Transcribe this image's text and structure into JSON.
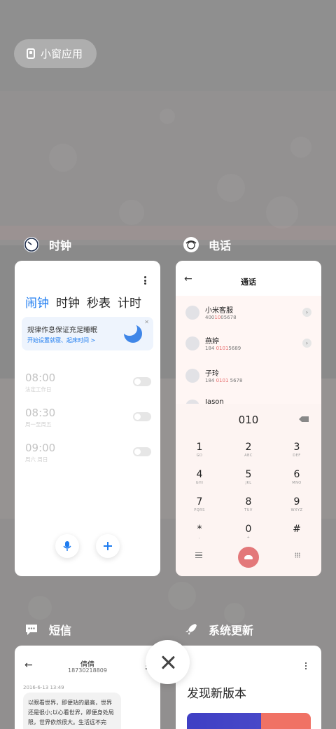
{
  "floating_button": {
    "label": "小窗应用",
    "icon": "small-window-icon"
  },
  "clock": {
    "app_name": "时钟",
    "icon": "clock-icon",
    "tabs": [
      "闹钟",
      "计时",
      "秒表",
      "计时"
    ],
    "tab_labels": {
      "alarm": "闹钟",
      "clock": "时钟",
      "stopwatch": "秒表",
      "timer": "计时"
    },
    "banner": {
      "title": "规律作息保证充足睡眠",
      "subtitle": "开始设置就寝、起床时间 >"
    },
    "alarms": [
      {
        "time": "08:00",
        "repeat": "法定工作日",
        "enabled": false
      },
      {
        "time": "08:30",
        "repeat": "周一至周五",
        "enabled": false
      },
      {
        "time": "09:00",
        "repeat": "周六 周日",
        "enabled": false
      }
    ],
    "mic_icon": "microphone-icon",
    "add_icon": "plus-icon"
  },
  "phone": {
    "app_name": "电话",
    "icon": "phone-icon",
    "title": "通话",
    "contacts": [
      {
        "name": "小米客服",
        "pre": "400",
        "hl": "10",
        "post": "05678"
      },
      {
        "name": "燕婷",
        "pre": "184 ",
        "hl": "0101",
        "post": "5689"
      },
      {
        "name": "子玲",
        "pre": "184 ",
        "hl": "0101",
        "post": " 5678"
      },
      {
        "name": "Jason",
        "pre": "",
        "hl": "",
        "post": ""
      }
    ],
    "dial_input": "010",
    "keys": [
      {
        "d": "1",
        "l": "GD"
      },
      {
        "d": "2",
        "l": "ABC"
      },
      {
        "d": "3",
        "l": "DEF"
      },
      {
        "d": "4",
        "l": "GHI"
      },
      {
        "d": "5",
        "l": "JKL"
      },
      {
        "d": "6",
        "l": "MNO"
      },
      {
        "d": "7",
        "l": "PQRS"
      },
      {
        "d": "8",
        "l": "TUV"
      },
      {
        "d": "9",
        "l": "WXYZ"
      },
      {
        "d": "*",
        "l": ","
      },
      {
        "d": "0",
        "l": "+"
      },
      {
        "d": "#",
        "l": ""
      }
    ]
  },
  "sms": {
    "app_name": "短信",
    "icon": "chat-bubble-icon",
    "contact_name": "倩倩",
    "contact_number": "18730218809",
    "timestamp": "2016-6-13 13:49",
    "message": "以眼看世界，即便站的最高，世界还是很小;以心看世界，即便身处局限，世界依然很大。生活远不完美，需要用心去体会，无需探究太多，需"
  },
  "update": {
    "app_name": "系统更新",
    "icon": "rocket-icon",
    "headline": "发现新版本"
  },
  "close_all": {
    "icon": "close-icon"
  },
  "colors": {
    "accent": "#1e7cf0",
    "call": "#e3787a",
    "highlight": "#e66b6b"
  }
}
